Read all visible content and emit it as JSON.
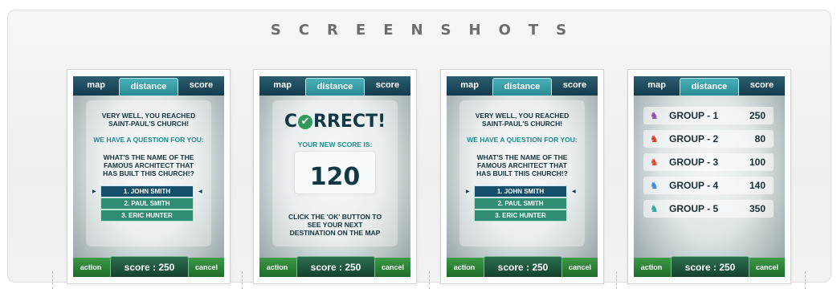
{
  "heading": "SCREENSHOTS",
  "tabs": {
    "map": "map",
    "distance": "distance",
    "score": "score"
  },
  "bottom": {
    "action": "action",
    "score": "score : 250",
    "cancel": "cancel"
  },
  "question": {
    "line1": "VERY WELL, YOU REACHED",
    "line2": "SAINT-PAUL'S CHURCH!",
    "intro": "WE HAVE A QUESTION FOR YOU:",
    "q1": "WHAT'S THE NAME OF THE",
    "q2": "FAMOUS ARCHITECT THAT",
    "q3": "HAS BUILT THIS CHURCH!?",
    "answers": [
      "1. JOHN SMITH",
      "2. PAUL SMITH",
      "3. ERIC HUNTER"
    ]
  },
  "correct": {
    "pre": "C",
    "post": "RRECT!",
    "check_icon": "check-icon",
    "new_score_label": "YOUR NEW SCORE IS:",
    "new_score": "120",
    "hint1": "CLICK THE 'OK' BUTTON TO",
    "hint2": "SEE YOUR NEXT",
    "hint3": "DESTINATION ON THE MAP"
  },
  "groups": [
    {
      "name": "GROUP - 1",
      "score": "250",
      "color": "#9b3fb5"
    },
    {
      "name": "GROUP - 2",
      "score": "80",
      "color": "#d8352a"
    },
    {
      "name": "GROUP - 3",
      "score": "100",
      "color": "#e3442e"
    },
    {
      "name": "GROUP - 4",
      "score": "140",
      "color": "#3d86d6"
    },
    {
      "name": "GROUP - 5",
      "score": "350",
      "color": "#2fa6a0"
    }
  ]
}
